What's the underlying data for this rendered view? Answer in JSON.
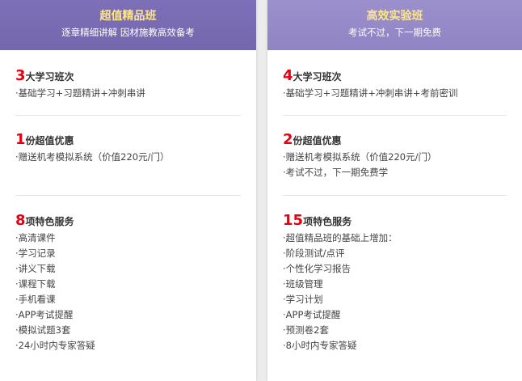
{
  "left": {
    "title": "超值精品班",
    "subtitle": "逐章精细讲解 因材施教高效备考",
    "sections": [
      {
        "num": "3",
        "label": "大学习班次",
        "items": [
          "·基础学习+习题精讲+冲刺串讲"
        ]
      },
      {
        "num": "1",
        "label": "份超值优惠",
        "items": [
          "·赠送机考模拟系统（价值220元/门）"
        ]
      },
      {
        "num": "8",
        "label": "项特色服务",
        "items": [
          "·高清课件",
          "·学习记录",
          "·讲义下载",
          "·课程下载",
          "·手机看课",
          "·APP考试提醒",
          "·模拟试题3套",
          "·24小时内专家答疑"
        ]
      }
    ]
  },
  "right": {
    "title": "高效实验班",
    "subtitle": "考试不过，下一期免费",
    "sections": [
      {
        "num": "4",
        "label": "大学习班次",
        "items": [
          "·基础学习+习题精讲+冲刺串讲+考前密训"
        ]
      },
      {
        "num": "2",
        "label": "份超值优惠",
        "items": [
          "·赠送机考模拟系统（价值220元/门）",
          "·考试不过，下一期免费学"
        ]
      },
      {
        "num": "15",
        "label": "项特色服务",
        "items": [
          "·超值精品班的基础上增加：",
          "·阶段测试/点评",
          "·个性化学习报告",
          "·班级管理",
          "·学习计划",
          "·APP考试提醒",
          "·预测卷2套",
          "·8小时内专家答疑"
        ]
      }
    ]
  }
}
